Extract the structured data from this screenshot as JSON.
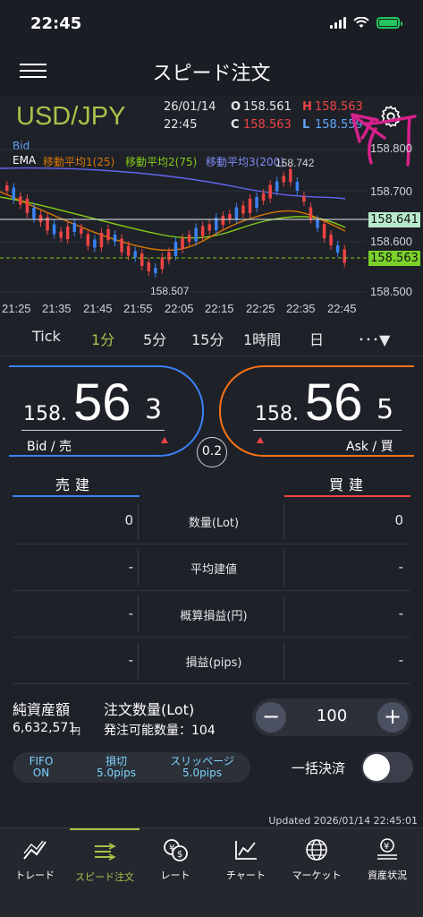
{
  "status_bar": {
    "time": "22:45"
  },
  "header": {
    "title": "スピード注文"
  },
  "quote": {
    "pair": "USD/JPY",
    "date": "26/01/14",
    "time": "22:45",
    "open_label": "O",
    "open": "158.561",
    "high_label": "H",
    "high": "158.563",
    "close_label": "C",
    "close": "158.563",
    "low_label": "L",
    "low": "158.559"
  },
  "chart": {
    "bid_label": "Bid",
    "ema_label": "EMA",
    "ema1": "移動平均1(25)",
    "ema2": "移動平均2(75)",
    "ema3": "移動平均3(200)",
    "y_ticks": [
      "158.800",
      "158.700",
      "158.600",
      "158.500"
    ],
    "x_ticks": [
      "21:25",
      "21:35",
      "21:45",
      "21:55",
      "22:05",
      "22:15",
      "22:25",
      "22:35",
      "22:45"
    ],
    "high_marker": "158.742",
    "low_marker": "158.507",
    "price_tag_1": "158.641",
    "price_tag_2": "158.563",
    "colors": {
      "up": "#ef4444",
      "down": "#3b82f6",
      "ema1": "#d97706",
      "ema2": "#84cc16",
      "ema3": "#6366f1",
      "accent": "#a6c34a"
    }
  },
  "timeframes": [
    "Tick",
    "1分",
    "5分",
    "15分",
    "1時間",
    "日",
    "･･･▼"
  ],
  "timeframe_selected": "1分",
  "bid": {
    "prefix": "158.",
    "big": "56",
    "last": "3",
    "label": "Bid / 売"
  },
  "ask": {
    "prefix": "158.",
    "big": "56",
    "last": "5",
    "label": "Ask / 買"
  },
  "spread": "0.2",
  "positions": {
    "sell_header": "売建",
    "buy_header": "買建",
    "rows": [
      {
        "label": "数量(Lot)",
        "sell": "0",
        "buy": "0"
      },
      {
        "label": "平均建値",
        "sell": "-",
        "buy": "-"
      },
      {
        "label": "概算損益(円)",
        "sell": "-",
        "buy": "-"
      },
      {
        "label": "損益(pips)",
        "sell": "-",
        "buy": "-"
      }
    ]
  },
  "account": {
    "net_assets_label": "純資産額",
    "net_assets_value": "6,632,571",
    "yen": "円",
    "order_qty_label": "注文数量(Lot)",
    "orderable_label": "発注可能数量：104",
    "qty": "100",
    "minus": "−",
    "plus": "+"
  },
  "settings_chip": {
    "fifo_l1": "FIFO",
    "fifo_l2": "ON",
    "stop_l1": "損切",
    "stop_l2": "5.0pips",
    "slip_l1": "スリッページ",
    "slip_l2": "5.0pips"
  },
  "bulk_close_label": "一括決済",
  "updated": "Updated  2026/01/14 22:45:01",
  "tabs": [
    {
      "label": "トレード",
      "icon": "trade-icon"
    },
    {
      "label": "スピード注文",
      "icon": "speed-order-icon"
    },
    {
      "label": "レート",
      "icon": "rate-icon"
    },
    {
      "label": "チャート",
      "icon": "chart-icon"
    },
    {
      "label": "マーケット",
      "icon": "market-icon"
    },
    {
      "label": "資産状況",
      "icon": "assets-icon"
    }
  ],
  "active_tab": "スピード注文"
}
